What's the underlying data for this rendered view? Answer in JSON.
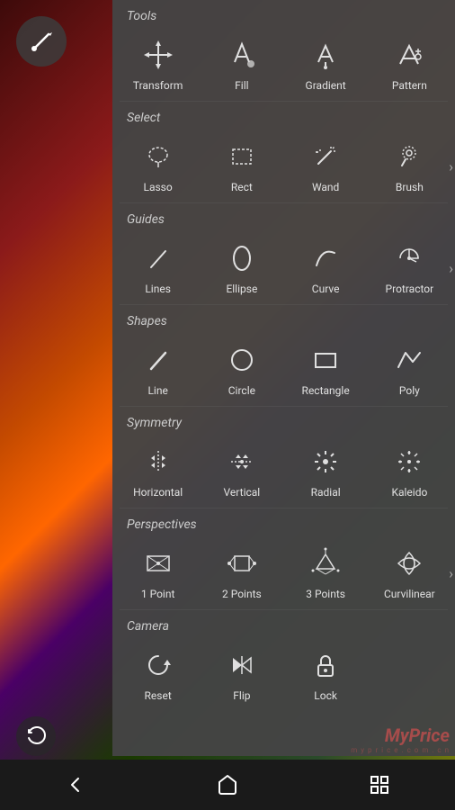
{
  "panel": {
    "sections": [
      {
        "title": "Tools",
        "items": [
          {
            "label": "Transform",
            "icon": "move"
          },
          {
            "label": "Fill",
            "icon": "fill"
          },
          {
            "label": "Gradient",
            "icon": "gradient"
          },
          {
            "label": "Pattern",
            "icon": "pattern"
          }
        ],
        "has_chevron": false
      },
      {
        "title": "Select",
        "items": [
          {
            "label": "Lasso",
            "icon": "lasso"
          },
          {
            "label": "Rect",
            "icon": "rect"
          },
          {
            "label": "Wand",
            "icon": "wand"
          },
          {
            "label": "Brush",
            "icon": "brush-select"
          }
        ],
        "has_chevron": true
      },
      {
        "title": "Guides",
        "items": [
          {
            "label": "Lines",
            "icon": "lines"
          },
          {
            "label": "Ellipse",
            "icon": "ellipse-guide"
          },
          {
            "label": "Curve",
            "icon": "curve"
          },
          {
            "label": "Protractor",
            "icon": "protractor"
          }
        ],
        "has_chevron": true
      },
      {
        "title": "Shapes",
        "items": [
          {
            "label": "Line",
            "icon": "line"
          },
          {
            "label": "Circle",
            "icon": "circle"
          },
          {
            "label": "Rectangle",
            "icon": "rectangle"
          },
          {
            "label": "Poly",
            "icon": "poly"
          }
        ],
        "has_chevron": false
      },
      {
        "title": "Symmetry",
        "items": [
          {
            "label": "Horizontal",
            "icon": "horizontal-sym"
          },
          {
            "label": "Vertical",
            "icon": "vertical-sym"
          },
          {
            "label": "Radial",
            "icon": "radial-sym"
          },
          {
            "label": "Kaleido",
            "icon": "kaleido-sym"
          }
        ],
        "has_chevron": false
      },
      {
        "title": "Perspectives",
        "items": [
          {
            "label": "1 Point",
            "icon": "1point"
          },
          {
            "label": "2 Points",
            "icon": "2points"
          },
          {
            "label": "3 Points",
            "icon": "3points"
          },
          {
            "label": "Curvilinear",
            "icon": "curvilinear"
          }
        ],
        "has_chevron": true
      },
      {
        "title": "Camera",
        "items": [
          {
            "label": "Reset",
            "icon": "reset"
          },
          {
            "label": "Flip",
            "icon": "flip"
          },
          {
            "label": "Lock",
            "icon": "lock"
          }
        ],
        "has_chevron": false
      }
    ]
  },
  "nav": {
    "back": "←",
    "home": "⌂",
    "apps": "⊞"
  },
  "watermark": {
    "text": "MyPrice",
    "subtext": "m y p r i c e . c o m . c n"
  }
}
